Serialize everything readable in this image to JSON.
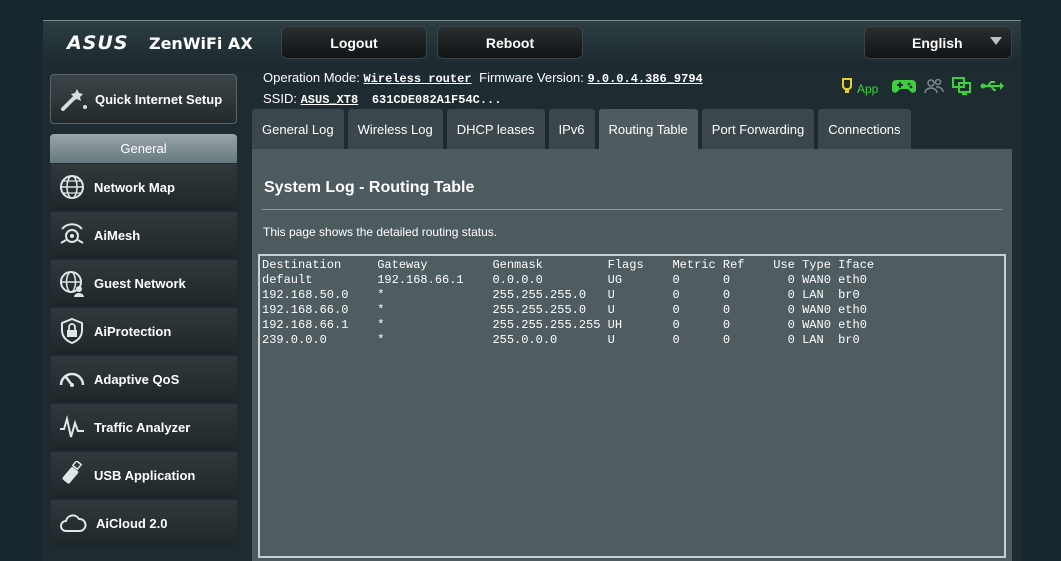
{
  "header": {
    "brand": "ASUS",
    "model": "ZenWiFi AX",
    "logout": "Logout",
    "reboot": "Reboot",
    "language": "English"
  },
  "info": {
    "op_mode_label": "Operation Mode:",
    "op_mode_value": "Wireless router",
    "fw_label": "Firmware Version:",
    "fw_value": "9.0.0.4.386_9794",
    "ssid_label": "SSID:",
    "ssid_value": "ASUS_XT8",
    "ssid_extra": "631CDE082A1F54C...",
    "app_label": "App"
  },
  "icons": {
    "app": "app-icon",
    "game": "gamepad-icon",
    "clients": "clients-icon",
    "network": "network-icon",
    "usb": "usb-icon",
    "app_color": "#3cd13c",
    "app_icon_color": "#e7d026"
  },
  "sidebar": {
    "quick_setup": "Quick Internet Setup",
    "general": "General",
    "items": [
      {
        "label": "Network Map",
        "icon": "globe-icon"
      },
      {
        "label": "AiMesh",
        "icon": "aimesh-icon"
      },
      {
        "label": "Guest Network",
        "icon": "guest-network-icon"
      },
      {
        "label": "AiProtection",
        "icon": "shield-lock-icon"
      },
      {
        "label": "Adaptive QoS",
        "icon": "gauge-icon"
      },
      {
        "label": "Traffic Analyzer",
        "icon": "waveform-icon"
      },
      {
        "label": "USB Application",
        "icon": "usb-stick-icon"
      },
      {
        "label": "AiCloud 2.0",
        "icon": "cloud-icon"
      }
    ]
  },
  "tabs": [
    {
      "label": "General Log",
      "active": false
    },
    {
      "label": "Wireless Log",
      "active": false
    },
    {
      "label": "DHCP leases",
      "active": false
    },
    {
      "label": "IPv6",
      "active": false
    },
    {
      "label": "Routing Table",
      "active": true
    },
    {
      "label": "Port Forwarding",
      "active": false
    },
    {
      "label": "Connections",
      "active": false
    }
  ],
  "content": {
    "title": "System Log - Routing Table",
    "description": "This page shows the detailed routing status.",
    "routing_table": "Destination     Gateway         Genmask         Flags    Metric Ref    Use Type Iface\ndefault         192.168.66.1    0.0.0.0         UG       0      0        0 WAN0 eth0\n192.168.50.0    *               255.255.255.0   U        0      0        0 LAN  br0\n192.168.66.0    *               255.255.255.0   U        0      0        0 WAN0 eth0\n192.168.66.1    *               255.255.255.255 UH       0      0        0 WAN0 eth0\n239.0.0.0       *               255.0.0.0       U        0      0        0 LAN  br0"
  }
}
